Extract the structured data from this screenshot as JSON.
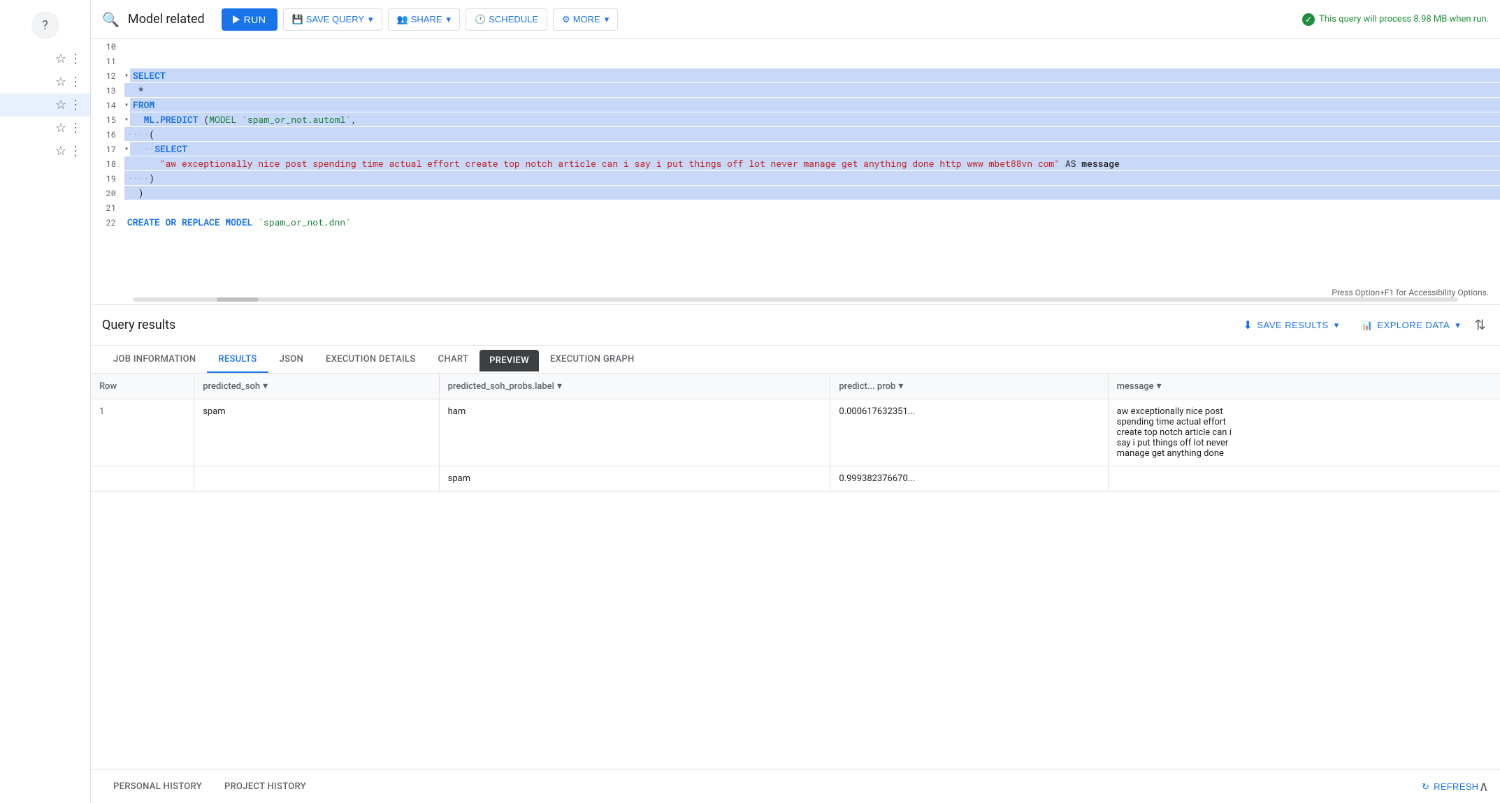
{
  "toolbar": {
    "search_icon": "🔍",
    "title": "Model related",
    "run_label": "RUN",
    "save_query_label": "SAVE QUERY",
    "share_label": "SHARE",
    "schedule_label": "SCHEDULE",
    "more_label": "MORE",
    "query_info": "This query will process 8.98 MB when run."
  },
  "code": {
    "accessibility_text": "Press Option+F1 for Accessibility Options.",
    "lines": [
      {
        "num": 10,
        "content": "",
        "selected": false
      },
      {
        "num": 11,
        "content": "",
        "selected": false
      },
      {
        "num": 12,
        "content": "SELECT",
        "selected": true,
        "collapse": true,
        "keyword": "SELECT"
      },
      {
        "num": 13,
        "content": "  *",
        "selected": true
      },
      {
        "num": 14,
        "content": "FROM",
        "selected": true,
        "collapse": true,
        "keyword": "FROM"
      },
      {
        "num": 15,
        "content": "  ML.PREDICT (MODEL `spam_or_not.automl`,",
        "selected": true,
        "collapse": true
      },
      {
        "num": 16,
        "content": "    (",
        "selected": true
      },
      {
        "num": 17,
        "content": "    SELECT",
        "selected": true,
        "collapse": true
      },
      {
        "num": 18,
        "content": "      \"aw exceptionally nice post spending time actual effort create top notch article can i say i put things off lot never manage get anything done http www mbet88vn com\" AS message",
        "selected": true
      },
      {
        "num": 19,
        "content": "    )",
        "selected": true
      },
      {
        "num": 20,
        "content": "  )",
        "selected": true
      },
      {
        "num": 21,
        "content": "",
        "selected": false
      },
      {
        "num": 22,
        "content": "CREATE OR REPLACE MODEL `spam_or_not.dnn`",
        "selected": false
      }
    ]
  },
  "results": {
    "title": "Query results",
    "save_results_label": "SAVE RESULTS",
    "explore_data_label": "EXPLORE DATA",
    "tabs": [
      {
        "id": "job-information",
        "label": "JOB INFORMATION",
        "active": false
      },
      {
        "id": "results",
        "label": "RESULTS",
        "active": true
      },
      {
        "id": "json",
        "label": "JSON",
        "active": false
      },
      {
        "id": "execution-details",
        "label": "EXECUTION DETAILS",
        "active": false
      },
      {
        "id": "chart",
        "label": "CHART",
        "active": false
      },
      {
        "id": "preview",
        "label": "PREVIEW",
        "active": false,
        "special": true
      },
      {
        "id": "execution-graph",
        "label": "EXECUTION GRAPH",
        "active": false
      }
    ],
    "columns": [
      {
        "id": "row",
        "label": "Row"
      },
      {
        "id": "predicted_soh",
        "label": "predicted_soh",
        "filter": true
      },
      {
        "id": "predicted_soh_probs_label",
        "label": "predicted_soh_probs.label",
        "filter": true
      },
      {
        "id": "predicted_prob",
        "label": "predict... prob",
        "filter": true
      },
      {
        "id": "message",
        "label": "message",
        "filter": true
      }
    ],
    "rows": [
      {
        "row": "1",
        "predicted_soh": "spam",
        "predicted_soh_probs_label_1": "ham",
        "predicted_prob_1": "0.000617632351...",
        "message_lines": [
          "aw exceptionally nice post",
          "spending time actual effort",
          "create top notch article can i",
          "say i put things off lot never",
          "manage get anything done"
        ]
      }
    ],
    "row2_label": "spam",
    "row2_prob": "0.999382376670..."
  },
  "bottom": {
    "personal_history_label": "PERSONAL HISTORY",
    "project_history_label": "PROJECT HISTORY",
    "refresh_label": "REFRESH"
  },
  "sidebar": {
    "help_icon": "?",
    "items": [
      {
        "star": "☆",
        "active": false
      },
      {
        "star": "☆",
        "active": false
      },
      {
        "star": "☆",
        "active": true
      },
      {
        "star": "☆",
        "active": false
      },
      {
        "star": "☆",
        "active": false
      }
    ]
  }
}
